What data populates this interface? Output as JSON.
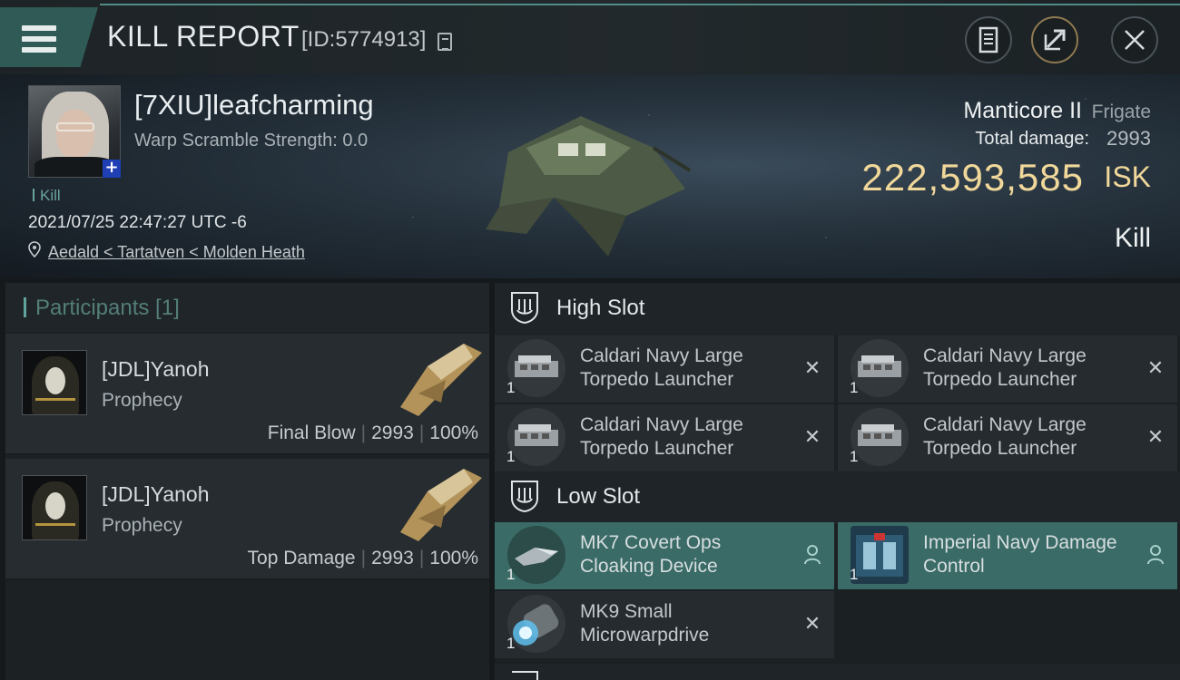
{
  "header": {
    "title": "KILL REPORT",
    "id_text": "[ID:5774913]",
    "icons": [
      "menu-icon",
      "copy-icon",
      "clipboard-icon",
      "share-icon",
      "close-icon"
    ]
  },
  "victim": {
    "name": "[7XIU]leafcharming",
    "warp_scramble": "Warp Scramble Strength: 0.0",
    "kill_tag": "Kill",
    "datetime": "2021/07/25 22:47:27 UTC -6",
    "location": "Aedald < Tartatven < Molden Heath"
  },
  "ship": {
    "name": "Manticore II",
    "class": "Frigate",
    "damage_label": "Total damage:",
    "damage_value": "2993",
    "isk_value": "222,593,585",
    "isk_unit": "ISK",
    "result": "Kill"
  },
  "participants": {
    "title": "Participants [1]",
    "rows": [
      {
        "name": "[JDL]Yanoh",
        "ship": "Prophecy",
        "role": "Final Blow",
        "damage": "2993",
        "percent": "100%"
      },
      {
        "name": "[JDL]Yanoh",
        "ship": "Prophecy",
        "role": "Top Damage",
        "damage": "2993",
        "percent": "100%"
      }
    ]
  },
  "slots": {
    "high": {
      "label": "High Slot",
      "modules": [
        {
          "qty": "1",
          "name": "Caldari Navy Large Torpedo Launcher",
          "status": "destroyed"
        },
        {
          "qty": "1",
          "name": "Caldari Navy Large Torpedo Launcher",
          "status": "destroyed"
        },
        {
          "qty": "1",
          "name": "Caldari Navy Large Torpedo Launcher",
          "status": "destroyed"
        },
        {
          "qty": "1",
          "name": "Caldari Navy Large Torpedo Launcher",
          "status": "destroyed"
        }
      ]
    },
    "low": {
      "label": "Low Slot",
      "modules": [
        {
          "qty": "1",
          "name": "MK7 Covert Ops Cloaking Device",
          "status": "dropped"
        },
        {
          "qty": "1",
          "name": "Imperial Navy Damage Control",
          "status": "dropped"
        },
        {
          "qty": "1",
          "name": "MK9 Small Microwarpdrive",
          "status": "destroyed"
        }
      ]
    }
  },
  "colors": {
    "accent": "#5fa59d",
    "isk": "#f0d79a",
    "equipped_bg": "#3a6b66"
  }
}
